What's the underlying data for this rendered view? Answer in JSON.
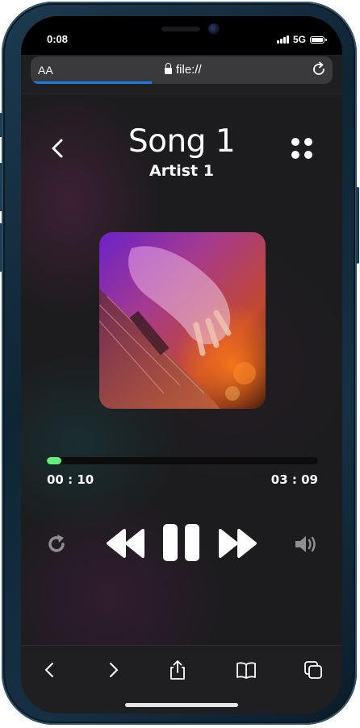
{
  "status_bar": {
    "time": "0:08",
    "network": "5G"
  },
  "browser": {
    "text_size_label": "AA",
    "url": "file://",
    "load_progress": 0.4,
    "accent_color": "#1f7ae0"
  },
  "player": {
    "song_title": "Song 1",
    "artist": "Artist 1",
    "current_time": "00 : 10",
    "total_time": "03 : 09",
    "progress_fraction": 0.053,
    "progress_color": "#5ef27a"
  },
  "controls": {
    "repeat": "repeat-icon",
    "rewind": "rewind-icon",
    "pause": "pause-icon",
    "fast_forward": "fast-forward-icon",
    "volume": "volume-icon"
  },
  "toolbar": {
    "items": [
      "back-arrow-icon",
      "forward-arrow-icon",
      "share-icon",
      "bookmarks-icon",
      "tabs-icon"
    ]
  }
}
